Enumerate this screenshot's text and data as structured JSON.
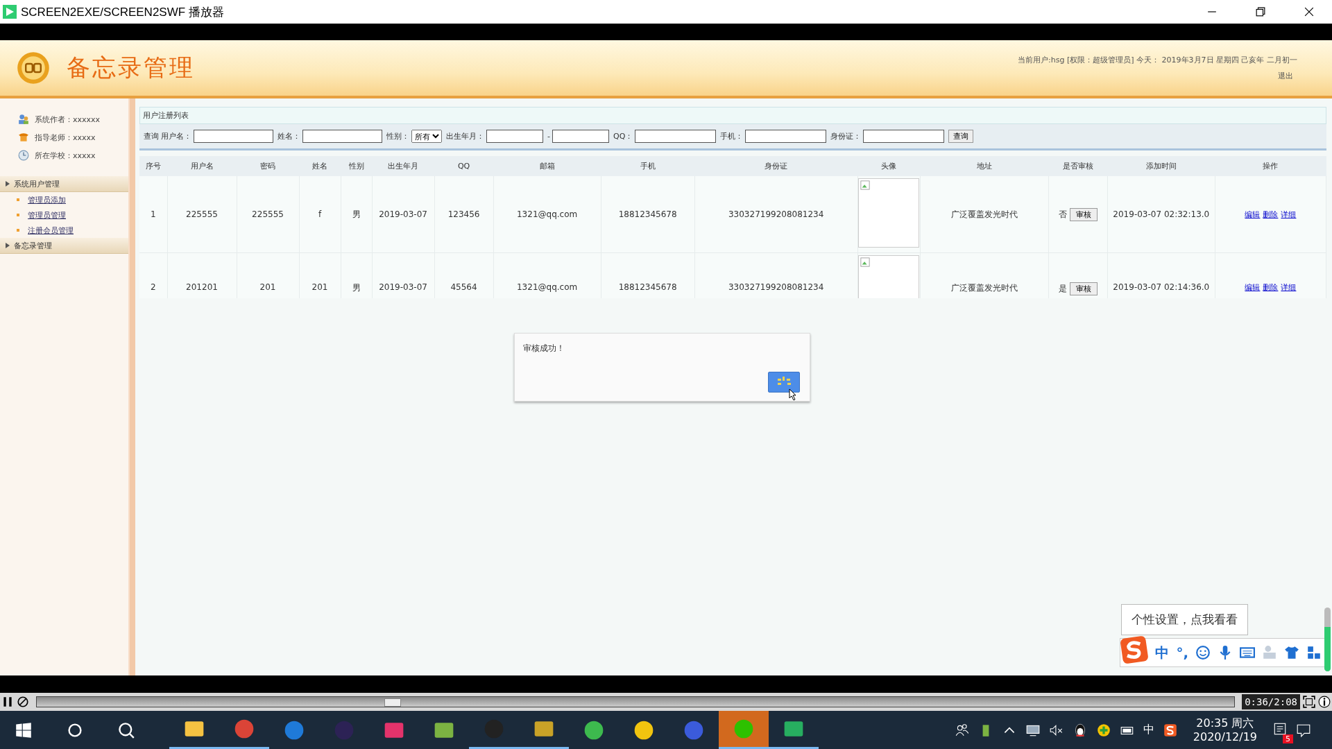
{
  "window": {
    "title": "SCREEN2EXE/SCREEN2SWF 播放器"
  },
  "header": {
    "title": "备忘录管理",
    "user_info": "当前用户:hsg [权限：超级管理员] 今天： 2019年3月7日 星期四 己亥年 二月初一",
    "logout": "退出"
  },
  "sidebar": {
    "info": [
      {
        "kind": "author",
        "text": "系统作者：xxxxxx"
      },
      {
        "kind": "teacher",
        "text": "指导老师：xxxxx"
      },
      {
        "kind": "school",
        "text": "所在学校：xxxxx"
      }
    ],
    "groups": [
      {
        "label": "系统用户管理",
        "children": [
          {
            "label": "管理员添加"
          },
          {
            "label": "管理员管理"
          },
          {
            "label": "注册会员管理"
          }
        ]
      },
      {
        "label": "备忘录管理"
      }
    ]
  },
  "panel": {
    "title": "用户注册列表",
    "filters": {
      "lead": "查询",
      "fields": [
        {
          "kind": "text",
          "label": "用户名："
        },
        {
          "kind": "text",
          "label": "姓名："
        },
        {
          "kind": "select",
          "label": "性别：",
          "value": "所有"
        },
        {
          "kind": "range",
          "label": "出生年月：",
          "separator": "-"
        },
        {
          "kind": "text",
          "label": "QQ："
        },
        {
          "kind": "text",
          "label": "手机："
        },
        {
          "kind": "text",
          "label": "身份证："
        }
      ],
      "button": "查询"
    },
    "table": {
      "columns": [
        "序号",
        "用户名",
        "密码",
        "姓名",
        "性别",
        "出生年月",
        "QQ",
        "邮箱",
        "手机",
        "身份证",
        "头像",
        "地址",
        "是否审核",
        "添加时间",
        "操作"
      ],
      "rows": [
        {
          "cells": [
            "1",
            "225555",
            "225555",
            "f",
            "男",
            "2019-03-07",
            "123456",
            "1321@qq.com",
            "18812345678",
            "330327199208081234"
          ],
          "address": "广泛覆盖发光时代",
          "reviewed": "否",
          "review_button": "审核",
          "added": "2019-03-07 02:32:13.0",
          "actions": [
            "编辑",
            "删除",
            "详细"
          ]
        },
        {
          "cells": [
            "2",
            "201201",
            "201",
            "201",
            "男",
            "2019-03-07",
            "45564",
            "1321@qq.com",
            "18812345678",
            "330327199208081234"
          ],
          "address": "广泛覆盖发光时代",
          "reviewed": "是",
          "review_button": "审核",
          "added": "2019-03-07 02:14:36.0",
          "actions": [
            "编辑",
            "删除",
            "详细"
          ]
        }
      ]
    }
  },
  "dialog": {
    "message": "审核成功！"
  },
  "ime": {
    "tooltip": "个性设置，点我看看",
    "mode": "中",
    "punct": "°,"
  },
  "player": {
    "level": 0.29,
    "time": "0:36/2:08"
  },
  "taskbar": {
    "apps": [
      {
        "kind": "explorer",
        "running": true,
        "flashing": false
      },
      {
        "kind": "chrome",
        "running": true,
        "flashing": false
      },
      {
        "kind": "edge",
        "running": false,
        "flashing": false
      },
      {
        "kind": "eclipse",
        "running": false,
        "flashing": false
      },
      {
        "kind": "idea",
        "running": false,
        "flashing": false
      },
      {
        "kind": "notepad",
        "running": false,
        "flashing": false
      },
      {
        "kind": "qq",
        "running": true,
        "flashing": false
      },
      {
        "kind": "tools",
        "running": true,
        "flashing": false
      },
      {
        "kind": "browser",
        "running": false,
        "flashing": false
      },
      {
        "kind": "fruit",
        "running": false,
        "flashing": false
      },
      {
        "kind": "pen",
        "running": false,
        "flashing": false
      },
      {
        "kind": "wechat",
        "running": true,
        "flashing": true
      },
      {
        "kind": "player",
        "running": true,
        "flashing": false
      }
    ],
    "lang": "中",
    "time": "20:35 周六",
    "date": "2020/12/19",
    "notifications": "5"
  }
}
